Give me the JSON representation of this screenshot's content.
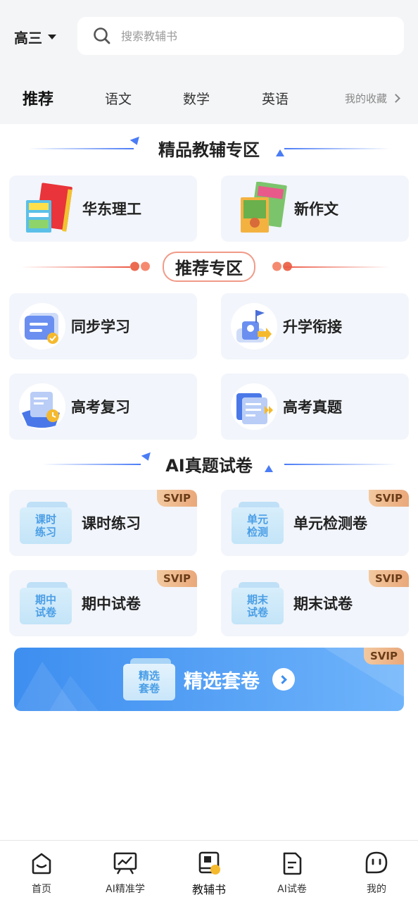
{
  "header": {
    "grade": "高三",
    "search_placeholder": "搜索教辅书"
  },
  "tabs": [
    {
      "label": "推荐",
      "active": true
    },
    {
      "label": "语文",
      "active": false
    },
    {
      "label": "数学",
      "active": false
    },
    {
      "label": "英语",
      "active": false
    }
  ],
  "favorites_label": "我的收藏",
  "sections": {
    "premium": {
      "title": "精品教辅专区",
      "items": [
        {
          "label": "华东理工",
          "icon": "book-covers-icon"
        },
        {
          "label": "新作文",
          "icon": "book-covers-icon"
        }
      ]
    },
    "recommend": {
      "title": "推荐专区",
      "items": [
        {
          "label": "同步学习",
          "icon": "sync-study-icon"
        },
        {
          "label": "升学衔接",
          "icon": "flag-arrow-icon"
        },
        {
          "label": "高考复习",
          "icon": "review-clock-icon"
        },
        {
          "label": "高考真题",
          "icon": "exam-docs-icon"
        }
      ]
    },
    "ai_papers": {
      "title": "AI真题试卷",
      "items": [
        {
          "label": "课时练习",
          "icon_text_1": "课时",
          "icon_text_2": "练习",
          "badge": "SVIP"
        },
        {
          "label": "单元检测卷",
          "icon_text_1": "单元",
          "icon_text_2": "检测",
          "badge": "SVIP"
        },
        {
          "label": "期中试卷",
          "icon_text_1": "期中",
          "icon_text_2": "试卷",
          "badge": "SVIP"
        },
        {
          "label": "期末试卷",
          "icon_text_1": "期末",
          "icon_text_2": "试卷",
          "badge": "SVIP"
        }
      ]
    }
  },
  "banner": {
    "label": "精选套卷",
    "icon_text_1": "精选",
    "icon_text_2": "套卷",
    "badge": "SVIP"
  },
  "nav": [
    {
      "label": "首页",
      "icon": "home-face-icon",
      "active": false
    },
    {
      "label": "AI精准学",
      "icon": "chart-board-icon",
      "active": false
    },
    {
      "label": "教辅书",
      "icon": "book-icon",
      "active": true
    },
    {
      "label": "AI试卷",
      "icon": "paper-doc-icon",
      "active": false
    },
    {
      "label": "我的",
      "icon": "profile-face-icon",
      "active": false
    }
  ],
  "colors": {
    "accent_blue": "#4a7cf6",
    "accent_red": "#ec5a46",
    "tab_highlight": "#ffd54a",
    "card_bg": "#f2f5fb"
  }
}
